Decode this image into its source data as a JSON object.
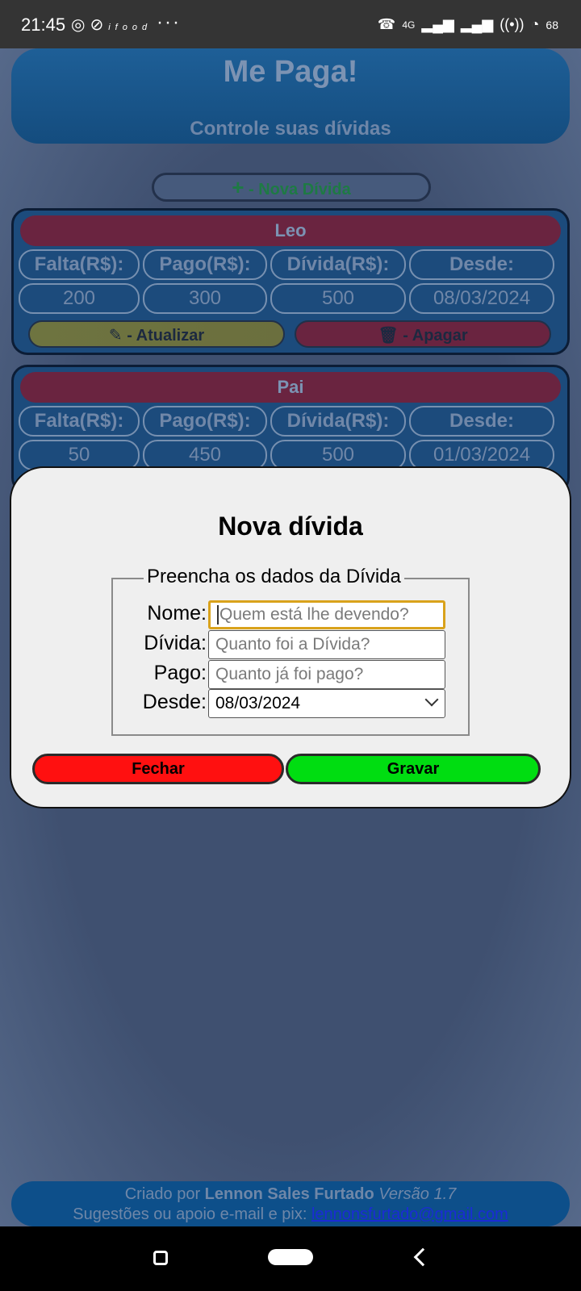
{
  "status_bar": {
    "time": "21:45",
    "left_icons": [
      "whatsapp-icon",
      "app-icon",
      "ifood-icon"
    ],
    "ifood_label": "ifood",
    "more": "···",
    "network": "4G",
    "battery": "68"
  },
  "app": {
    "title": "Me Paga!",
    "subtitle": "Controle suas dívidas",
    "new_debt_icon": "+",
    "new_debt_label": "- Nova Dívida",
    "headers": [
      "Falta(R$):",
      "Pago(R$):",
      "Dívida(R$):",
      "Desde:"
    ],
    "cards": [
      {
        "name": "Leo",
        "falta": "200",
        "pago": "300",
        "divida": "500",
        "desde": "08/03/2024",
        "update_label": "- Atualizar",
        "delete_label": "- Apagar"
      },
      {
        "name": "Pai",
        "falta": "50",
        "pago": "450",
        "divida": "500",
        "desde": "01/03/2024"
      }
    ]
  },
  "modal": {
    "title": "Nova dívida",
    "legend": "Preencha os dados da Dívida",
    "fields": {
      "nome_label": "Nome:",
      "nome_placeholder": "Quem está lhe devendo?",
      "divida_label": "Dívida:",
      "divida_placeholder": "Quanto foi a Dívida?",
      "pago_label": "Pago:",
      "pago_placeholder": "Quanto já foi pago?",
      "desde_label": "Desde:",
      "desde_value": "08/03/2024"
    },
    "close_label": "Fechar",
    "save_label": "Gravar",
    "colors": {
      "close": "#ff1010",
      "save": "#00dd11"
    }
  },
  "footer": {
    "created_by": "Criado por",
    "author": "Lennon Sales Furtado",
    "version": "Versão 1.7",
    "support_text": "Sugestões ou apoio e-mail e pix:",
    "email": "lennonsfurtado@gmail.com"
  }
}
